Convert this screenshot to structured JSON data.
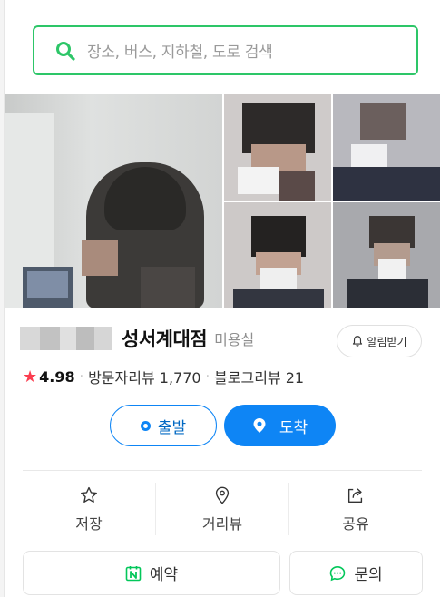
{
  "search": {
    "placeholder": "장소, 버스, 지하철, 도로 검색",
    "accent": "#2dc668"
  },
  "place": {
    "name": "성서계대점",
    "category": "미용실",
    "notify_label": "알림받기",
    "rating_star": "★",
    "rating": "4.98",
    "visitor_reviews": "방문자리뷰 1,770",
    "blog_reviews": "블로그리뷰 21"
  },
  "route": {
    "start_label": "출발",
    "arrive_label": "도착",
    "accent": "#0e85f5"
  },
  "actions": [
    {
      "label": "저장",
      "icon": "star-outline-icon"
    },
    {
      "label": "거리뷰",
      "icon": "map-pin-outline-icon"
    },
    {
      "label": "공유",
      "icon": "share-icon"
    }
  ],
  "bottom": {
    "book_label": "예약",
    "inquiry_label": "문의"
  }
}
